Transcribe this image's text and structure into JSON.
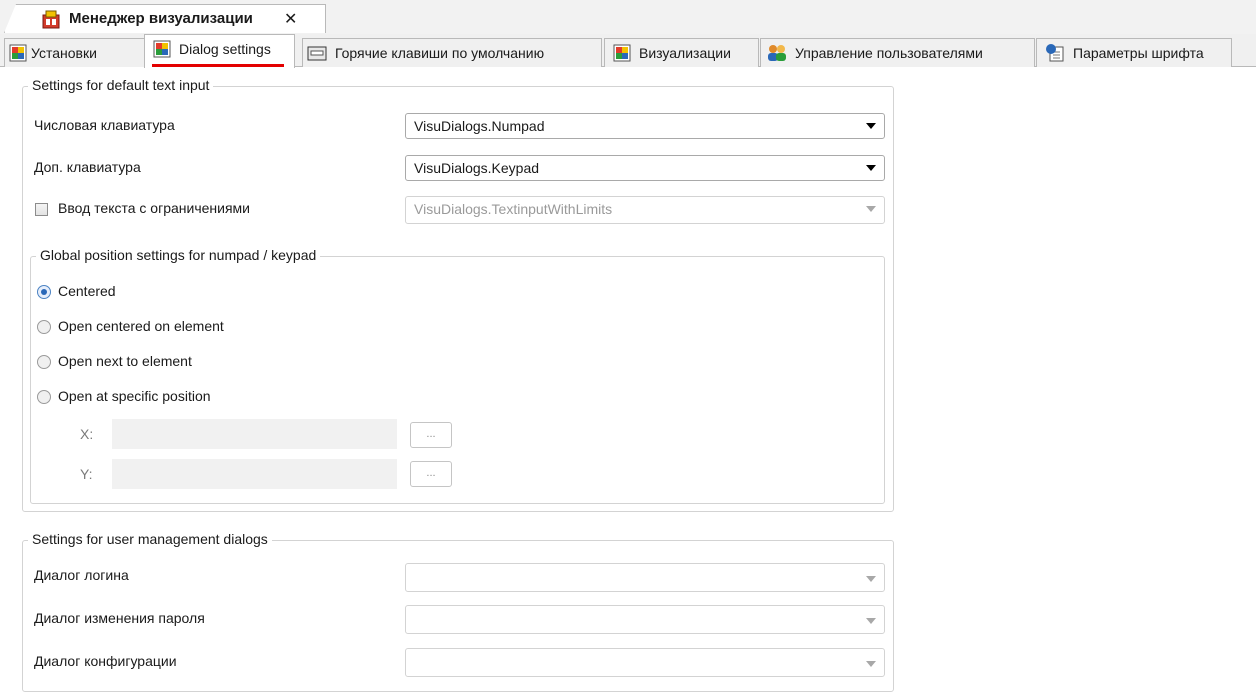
{
  "document_tab": {
    "title": "Менеджер визуализации",
    "close_glyph": "✕",
    "icon": "visu-manager-icon"
  },
  "tabs": [
    {
      "label": "Установки",
      "icon": "visu-icon",
      "active": false
    },
    {
      "label": "Dialog settings",
      "icon": "visu-icon",
      "active": true
    },
    {
      "label": "Горячие клавиши по умолчанию",
      "icon": "keyboard-icon",
      "active": false
    },
    {
      "label": "Визуализации",
      "icon": "visu-icon",
      "active": false
    },
    {
      "label": "Управление пользователями",
      "icon": "users-icon",
      "active": false
    },
    {
      "label": "Параметры шрифта",
      "icon": "font-icon",
      "active": false
    }
  ],
  "default_text_input": {
    "legend": "Settings for default text input",
    "numpad_label": "Числовая клавиатура",
    "numpad_value": "VisuDialogs.Numpad",
    "keypad_label": "Доп. клавиатура",
    "keypad_value": "VisuDialogs.Keypad",
    "limits_label": "Ввод текста с ограничениями",
    "limits_checked": false,
    "limits_value": "VisuDialogs.TextinputWithLimits"
  },
  "position": {
    "legend": "Global position settings for numpad / keypad",
    "options": [
      {
        "label": "Centered",
        "selected": true
      },
      {
        "label": "Open centered on element",
        "selected": false
      },
      {
        "label": "Open next to element",
        "selected": false
      },
      {
        "label": "Open at specific position",
        "selected": false
      }
    ],
    "x_label": "X:",
    "y_label": "Y:",
    "browse_label": "..."
  },
  "user_management": {
    "legend": "Settings for user management dialogs",
    "login_label": "Диалог логина",
    "password_label": "Диалог изменения пароля",
    "config_label": "Диалог конфигурации"
  },
  "colors": {
    "active_tab_underline": "#e30000",
    "radio_selected": "#2a68b8"
  }
}
